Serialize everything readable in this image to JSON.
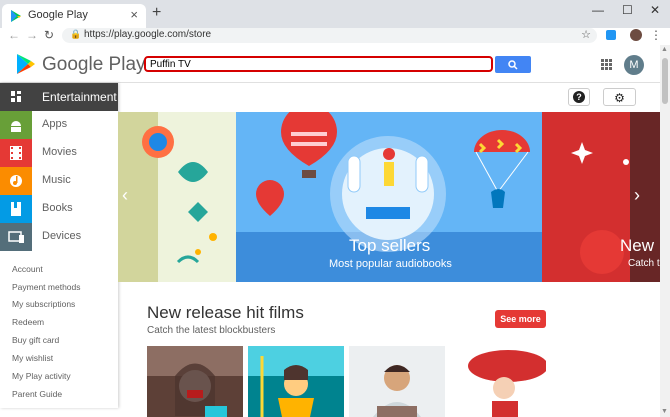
{
  "browser": {
    "tab_title": "Google Play",
    "new_tab": "+",
    "tab_close": "×",
    "url": "https://play.google.com/store",
    "window_controls": {
      "minimize": "—",
      "maximize": "☐",
      "close": "✕"
    }
  },
  "header": {
    "logo_text": "Google Play",
    "search_value": "Puffin TV",
    "avatar_letter": "M"
  },
  "subbar": {
    "help": "?",
    "settings": "⚙"
  },
  "sidebar": {
    "categories": [
      {
        "label": "Entertainment",
        "color": "#424242"
      },
      {
        "label": "Apps",
        "color": "#689f38"
      },
      {
        "label": "Movies",
        "color": "#e53935"
      },
      {
        "label": "Music",
        "color": "#fb8c00"
      },
      {
        "label": "Books",
        "color": "#039be5"
      },
      {
        "label": "Devices",
        "color": "#546e7a"
      }
    ],
    "links": [
      "Account",
      "Payment methods",
      "My subscriptions",
      "Redeem",
      "Buy gift card",
      "My wishlist",
      "My Play activity",
      "Parent Guide"
    ]
  },
  "banner": {
    "title": "Top sellers",
    "subtitle": "Most popular audiobooks",
    "next_peek_title": "New",
    "next_peek_sub": "Catch t"
  },
  "section": {
    "title": "New release hit films",
    "subtitle": "Catch the latest blockbusters",
    "see_more": "See more"
  },
  "colors": {
    "play_red": "#e53935",
    "search_blue": "#4285f4",
    "search_outline": "#d50000"
  }
}
